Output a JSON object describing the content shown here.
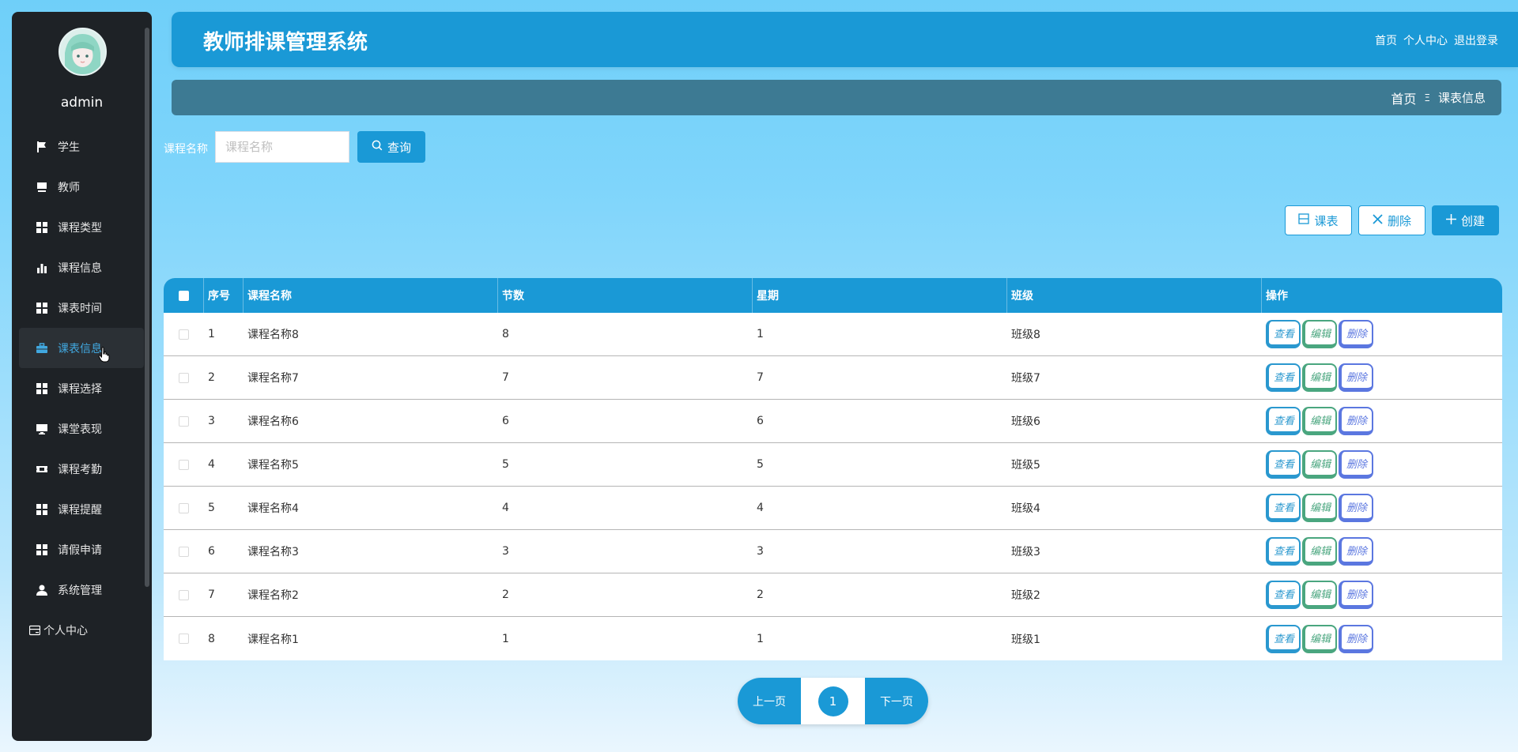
{
  "header": {
    "title": "教师排课管理系统",
    "links": [
      "首页",
      "个人中心",
      "退出登录"
    ]
  },
  "sidebar": {
    "username": "admin",
    "items": [
      {
        "label": "学生",
        "icon": "flag-icon"
      },
      {
        "label": "教师",
        "icon": "desk-icon"
      },
      {
        "label": "课程类型",
        "icon": "grid-icon"
      },
      {
        "label": "课程信息",
        "icon": "bar-chart-icon"
      },
      {
        "label": "课表时间",
        "icon": "grid-icon"
      },
      {
        "label": "课表信息",
        "icon": "briefcase-icon",
        "active": true
      },
      {
        "label": "课程选择",
        "icon": "grid-icon"
      },
      {
        "label": "课堂表现",
        "icon": "monitor-icon"
      },
      {
        "label": "课程考勤",
        "icon": "ticket-icon"
      },
      {
        "label": "课程提醒",
        "icon": "grid-icon"
      },
      {
        "label": "请假申请",
        "icon": "grid-icon"
      },
      {
        "label": "系统管理",
        "icon": "user-icon"
      },
      {
        "label": "个人中心",
        "icon": "id-card-icon"
      }
    ]
  },
  "breadcrumb": {
    "home": "首页",
    "separator": "Ξ",
    "current": "课表信息"
  },
  "search": {
    "label": "课程名称",
    "placeholder": "课程名称",
    "button": "查询"
  },
  "actions": {
    "schedule": "课表",
    "delete": "删除",
    "create": "创建"
  },
  "table": {
    "columns": [
      "序号",
      "课程名称",
      "节数",
      "星期",
      "班级",
      "操作"
    ],
    "rows": [
      {
        "idx": "1",
        "name": "课程名称8",
        "sections": "8",
        "week": "1",
        "cls": "班级8"
      },
      {
        "idx": "2",
        "name": "课程名称7",
        "sections": "7",
        "week": "7",
        "cls": "班级7"
      },
      {
        "idx": "3",
        "name": "课程名称6",
        "sections": "6",
        "week": "6",
        "cls": "班级6"
      },
      {
        "idx": "4",
        "name": "课程名称5",
        "sections": "5",
        "week": "5",
        "cls": "班级5"
      },
      {
        "idx": "5",
        "name": "课程名称4",
        "sections": "4",
        "week": "4",
        "cls": "班级4"
      },
      {
        "idx": "6",
        "name": "课程名称3",
        "sections": "3",
        "week": "3",
        "cls": "班级3"
      },
      {
        "idx": "7",
        "name": "课程名称2",
        "sections": "2",
        "week": "2",
        "cls": "班级2"
      },
      {
        "idx": "8",
        "name": "课程名称1",
        "sections": "1",
        "week": "1",
        "cls": "班级1"
      }
    ],
    "row_ops": {
      "view": "查看",
      "edit": "编辑",
      "del": "删除"
    }
  },
  "pagination": {
    "prev": "上一页",
    "current": "1",
    "next": "下一页"
  },
  "colors": {
    "primary": "#1a99d6",
    "sidebar_bg": "#1e2226",
    "breadcrumb_bg": "#3d7a93",
    "active_text": "#41a8e0"
  }
}
